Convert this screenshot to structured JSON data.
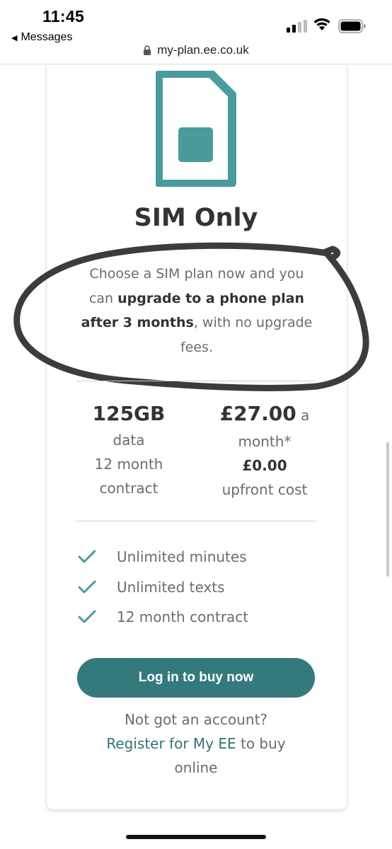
{
  "status_bar": {
    "time": "11:45",
    "back_label": "Messages"
  },
  "browser": {
    "url": "my-plan.ee.co.uk"
  },
  "plan": {
    "icon": "sim-card-icon",
    "title": "SIM Only",
    "description": {
      "part1": "Choose a SIM plan now and you can ",
      "bold": "upgrade to a phone plan after 3 months",
      "part2": ", with no upgrade fees."
    },
    "stats": {
      "data_amount": "125GB",
      "data_label": "data",
      "contract_line1": "12 month",
      "contract_line2": "contract",
      "price": "£27.00",
      "price_suffix": " a",
      "price_period": "month*",
      "upfront_price": "£0.00",
      "upfront_label": "upfront cost"
    },
    "features": [
      "Unlimited minutes",
      "Unlimited texts",
      "12 month contract"
    ],
    "cta_label": "Log in to buy now",
    "account_prompt": "Not got an account?",
    "register_link": "Register for My EE",
    "register_suffix": " to buy online"
  },
  "colors": {
    "accent": "#4a9c9c",
    "button": "#347a7d",
    "link": "#2f7477",
    "annotation": "#2b2b2b"
  }
}
